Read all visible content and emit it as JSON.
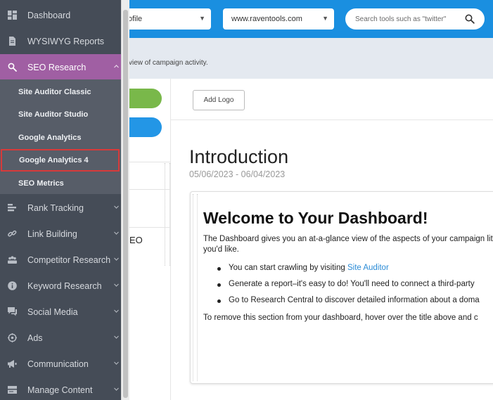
{
  "topbar": {
    "profile_select": "ofile",
    "site_select": "www.raventools.com",
    "search_placeholder": "Search tools such as \"twitter\""
  },
  "subheader": {
    "description": "view of campaign activity."
  },
  "leftcol": {
    "row_text": "EO"
  },
  "main": {
    "add_logo_label": "Add Logo",
    "intro_title": "Introduction",
    "date_range": "05/06/2023 - 06/04/2023",
    "card": {
      "title": "Welcome to Your Dashboard!",
      "intro": "The Dashboard gives you an at-a-glance view of the aspects of your campaign little as you'd like.",
      "bullets": [
        {
          "text": "You can start crawling by visiting ",
          "link": "Site Auditor"
        },
        {
          "text": "Generate a report–it's easy to do! You'll need to connect a third-party",
          "link": ""
        },
        {
          "text": "Go to Research Central to discover detailed information about a doma",
          "link": ""
        }
      ],
      "outro": "To remove this section from your dashboard, hover over the title above and c"
    }
  },
  "sidebar": {
    "items": [
      {
        "label": "Dashboard",
        "icon": "dashboard-icon"
      },
      {
        "label": "WYSIWYG Reports",
        "icon": "document-icon"
      },
      {
        "label": "SEO Research",
        "icon": "search-icon"
      },
      {
        "label": "Rank Tracking",
        "icon": "bar-chart-icon"
      },
      {
        "label": "Link Building",
        "icon": "link-icon"
      },
      {
        "label": "Competitor Research",
        "icon": "people-icon"
      },
      {
        "label": "Keyword Research",
        "icon": "info-icon"
      },
      {
        "label": "Social Media",
        "icon": "chat-icon"
      },
      {
        "label": "Ads",
        "icon": "target-icon"
      },
      {
        "label": "Communication",
        "icon": "megaphone-icon"
      },
      {
        "label": "Manage Content",
        "icon": "content-icon"
      }
    ],
    "seo_submenu": [
      {
        "label": "Site Auditor Classic"
      },
      {
        "label": "Site Auditor Studio"
      },
      {
        "label": "Google Analytics"
      },
      {
        "label": "Google Analytics 4"
      },
      {
        "label": "SEO Metrics"
      }
    ]
  },
  "colors": {
    "topbar": "#1a8fe0",
    "sidebar": "#454c57",
    "active": "#a05fa3",
    "highlight_border": "#d83a3a",
    "link": "#2a8bd6"
  }
}
